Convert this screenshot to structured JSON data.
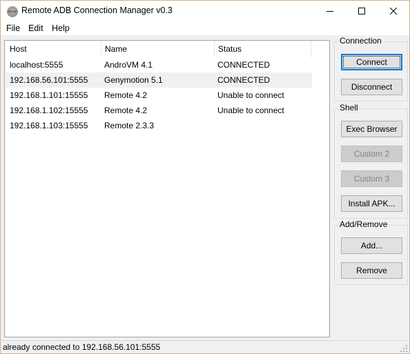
{
  "window": {
    "title": "Remote ADB Connection Manager v0.3",
    "icon_label": "RACM",
    "controls": {
      "minimize": "—",
      "maximize": "☐",
      "close": "✕"
    }
  },
  "menu": [
    "File",
    "Edit",
    "Help"
  ],
  "list": {
    "columns": [
      "Host",
      "Name",
      "Status"
    ],
    "rows": [
      {
        "host": "localhost:5555",
        "name": "AndroVM 4.1",
        "status": "CONNECTED"
      },
      {
        "host": "192.168.56.101:5555",
        "name": "Genymotion 5.1",
        "status": "CONNECTED"
      },
      {
        "host": "192.168.1.101:15555",
        "name": "Remote 4.2",
        "status": "Unable to connect"
      },
      {
        "host": "192.168.1.102:15555",
        "name": "Remote 4.2",
        "status": "Unable to connect"
      },
      {
        "host": "192.168.1.103:15555",
        "name": "Remote 2.3.3",
        "status": ""
      }
    ],
    "selected_index": 1
  },
  "groups": {
    "connection": {
      "label": "Connection",
      "buttons": [
        "Connect",
        "Disconnect"
      ]
    },
    "shell": {
      "label": "Shell",
      "buttons": [
        "Exec Browser",
        "Custom 2",
        "Custom 3",
        "Install APK..."
      ]
    },
    "add_remove": {
      "label": "Add/Remove",
      "buttons": [
        "Add...",
        "Remove"
      ]
    }
  },
  "status_bar": {
    "text": "already connected to 192.168.56.101:5555"
  },
  "colors": {
    "accent": "#0078d7",
    "window_border": "#d8ae8a",
    "selection": "#f0f0f0"
  }
}
